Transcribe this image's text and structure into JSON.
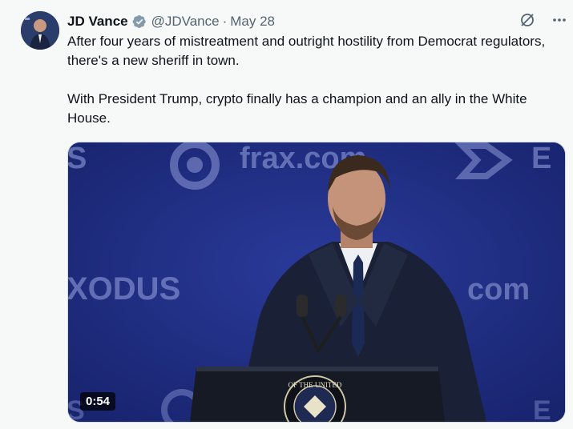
{
  "tweet": {
    "author_name": "JD Vance",
    "handle": "@JDVance",
    "separator": "·",
    "date": "May 28",
    "paragraphs": [
      "After four years of mistreatment and outright hostility from Democrat regulators, there's a new sheriff in town.",
      "With President Trump, crypto finally has a champion and an ally in the White House."
    ],
    "verified_color": "#829aab",
    "icons": {
      "verified": "verified-badge-icon",
      "grok": "grok-icon",
      "more": "more-icon"
    }
  },
  "media": {
    "type": "video",
    "duration": "0:54",
    "backdrop_text": {
      "left_top": "S",
      "center_top": "frax.com",
      "right_top": "E",
      "left_mid": "XODUS",
      "right_mid": "com",
      "bottom_left": "S",
      "bottom_right": "E"
    },
    "seal_text": "OF THE UNITED"
  }
}
